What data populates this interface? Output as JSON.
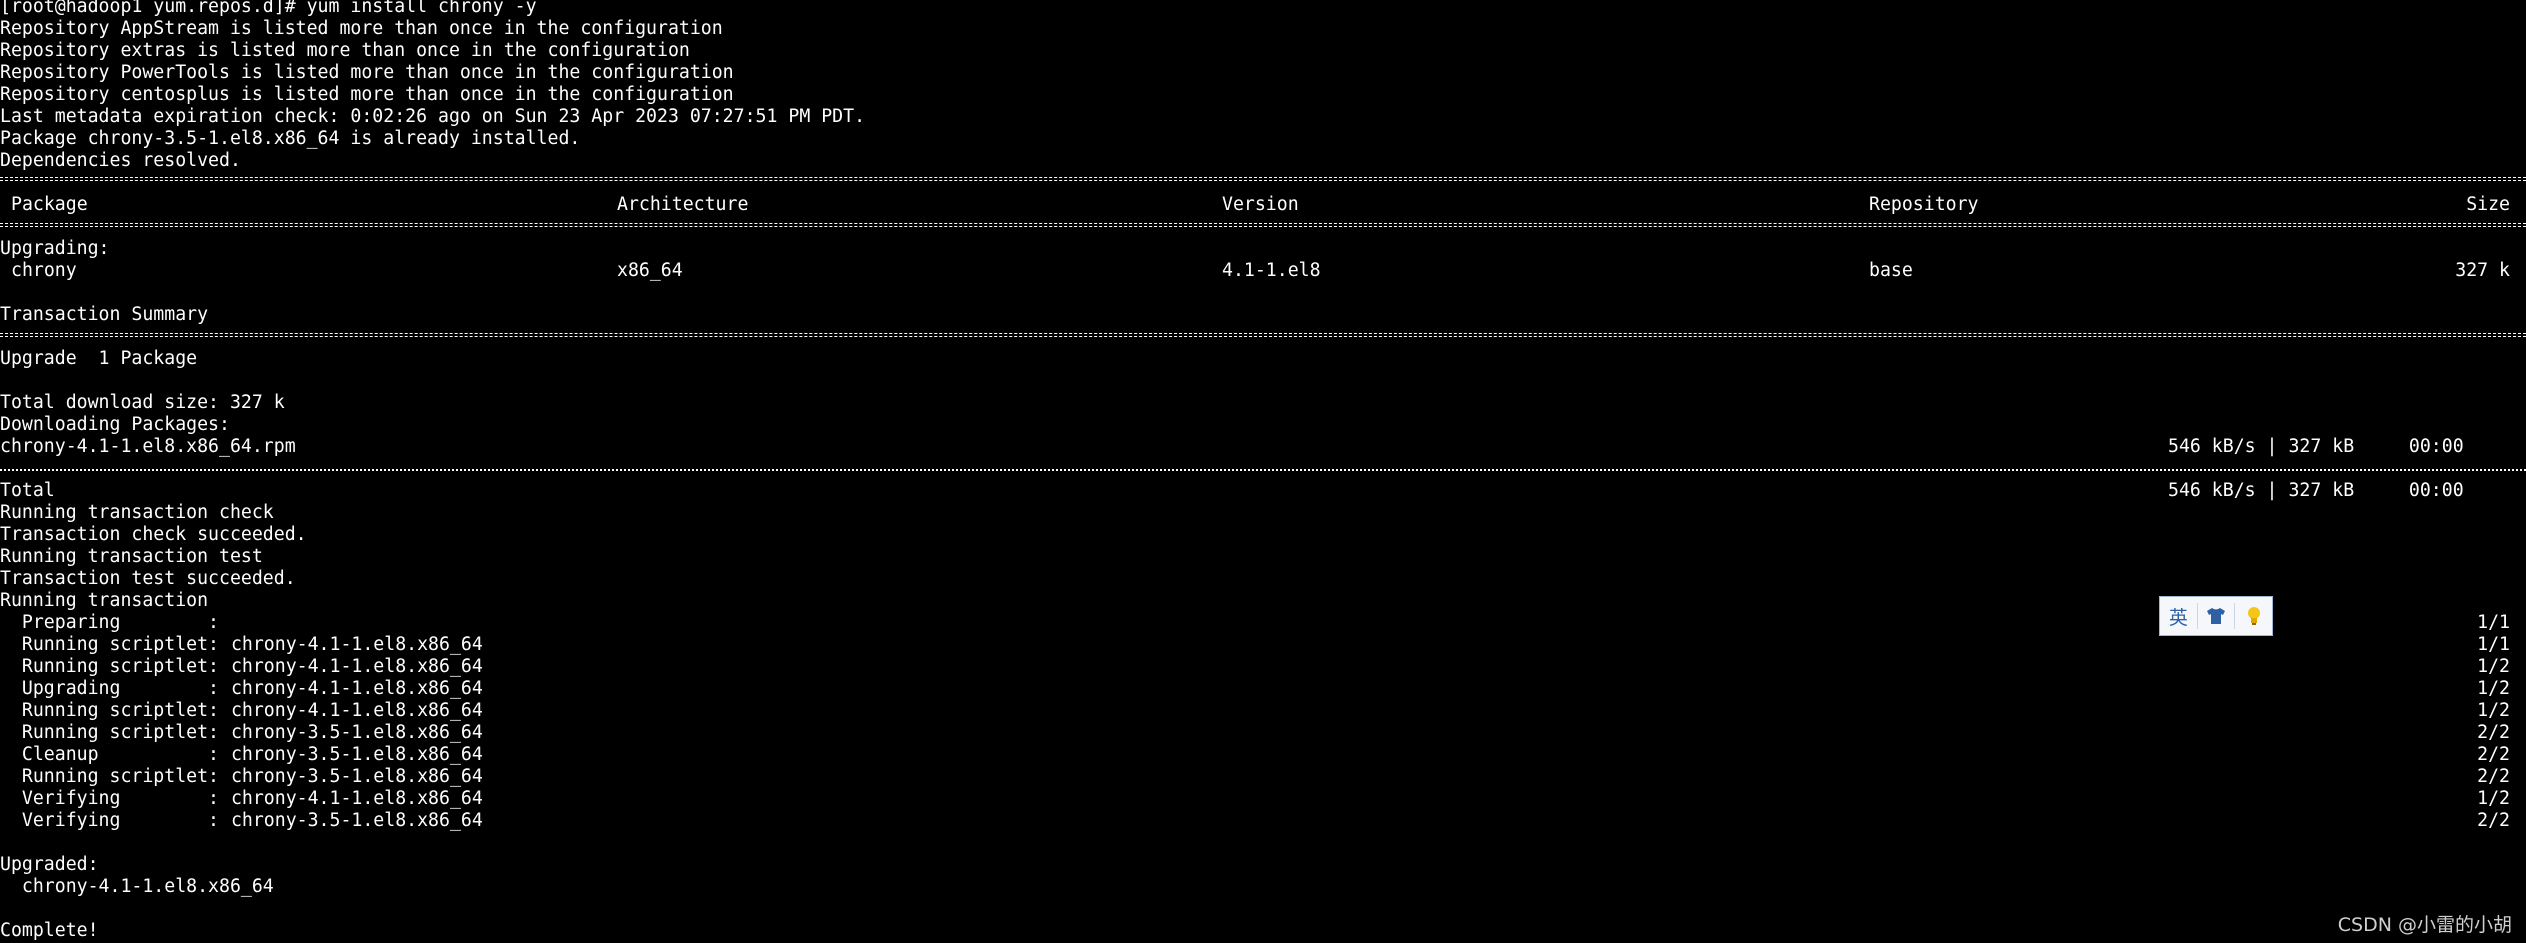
{
  "terminal": {
    "prompt_line": "[root@hadoop1 yum.repos.d]# yum install chrony -y",
    "warnings": [
      "Repository AppStream is listed more than once in the configuration",
      "Repository extras is listed more than once in the configuration",
      "Repository PowerTools is listed more than once in the configuration",
      "Repository centosplus is listed more than once in the configuration"
    ],
    "metadata_check": "Last metadata expiration check: 0:02:26 ago on Sun 23 Apr 2023 07:27:51 PM PDT.",
    "already_installed": "Package chrony-3.5-1.el8.x86_64 is already installed.",
    "deps_resolved": "Dependencies resolved.",
    "table_header": {
      "package": "Package",
      "architecture": "Architecture",
      "version": "Version",
      "repository": "Repository",
      "size": "Size"
    },
    "upgrading_label": "Upgrading:",
    "package_row": {
      "name": "chrony",
      "arch": "x86_64",
      "version": "4.1-1.el8",
      "repo": "base",
      "size": "327 k"
    },
    "transaction_summary": "Transaction Summary",
    "upgrade_count": "Upgrade  1 Package",
    "total_download": "Total download size: 327 k",
    "downloading": "Downloading Packages:",
    "rpm_file": "chrony-4.1-1.el8.x86_64.rpm",
    "rpm_speed": "546 kB/s | 327 kB     00:00",
    "total_label": "Total",
    "total_speed": "546 kB/s | 327 kB     00:00",
    "running_check": "Running transaction check",
    "check_succeeded": "Transaction check succeeded.",
    "running_test": "Running transaction test",
    "test_succeeded": "Transaction test succeeded.",
    "running_transaction": "Running transaction",
    "steps": [
      {
        "action": "  Preparing        :",
        "pkg": "",
        "progress": "1/1"
      },
      {
        "action": "  Running scriptlet:",
        "pkg": " chrony-4.1-1.el8.x86_64",
        "progress": "1/1"
      },
      {
        "action": "  Running scriptlet:",
        "pkg": " chrony-4.1-1.el8.x86_64",
        "progress": "1/2"
      },
      {
        "action": "  Upgrading        :",
        "pkg": " chrony-4.1-1.el8.x86_64",
        "progress": "1/2"
      },
      {
        "action": "  Running scriptlet:",
        "pkg": " chrony-4.1-1.el8.x86_64",
        "progress": "1/2"
      },
      {
        "action": "  Running scriptlet:",
        "pkg": " chrony-3.5-1.el8.x86_64",
        "progress": "2/2"
      },
      {
        "action": "  Cleanup          :",
        "pkg": " chrony-3.5-1.el8.x86_64",
        "progress": "2/2"
      },
      {
        "action": "  Running scriptlet:",
        "pkg": " chrony-3.5-1.el8.x86_64",
        "progress": "2/2"
      },
      {
        "action": "  Verifying        :",
        "pkg": " chrony-4.1-1.el8.x86_64",
        "progress": "1/2"
      },
      {
        "action": "  Verifying        :",
        "pkg": " chrony-3.5-1.el8.x86_64",
        "progress": "2/2"
      }
    ],
    "upgraded_label": "Upgraded:",
    "upgraded_pkg": "  chrony-4.1-1.el8.x86_64",
    "complete": "Complete!"
  },
  "ime_toolbar": {
    "lang_label": "英",
    "skin_icon": "shirt-icon",
    "settings_icon": "lightbulb-icon"
  },
  "watermark": "CSDN @小雷的小胡",
  "colors": {
    "background": "#000000",
    "text": "#ffffff",
    "ime_accent": "#2f5fa4"
  }
}
